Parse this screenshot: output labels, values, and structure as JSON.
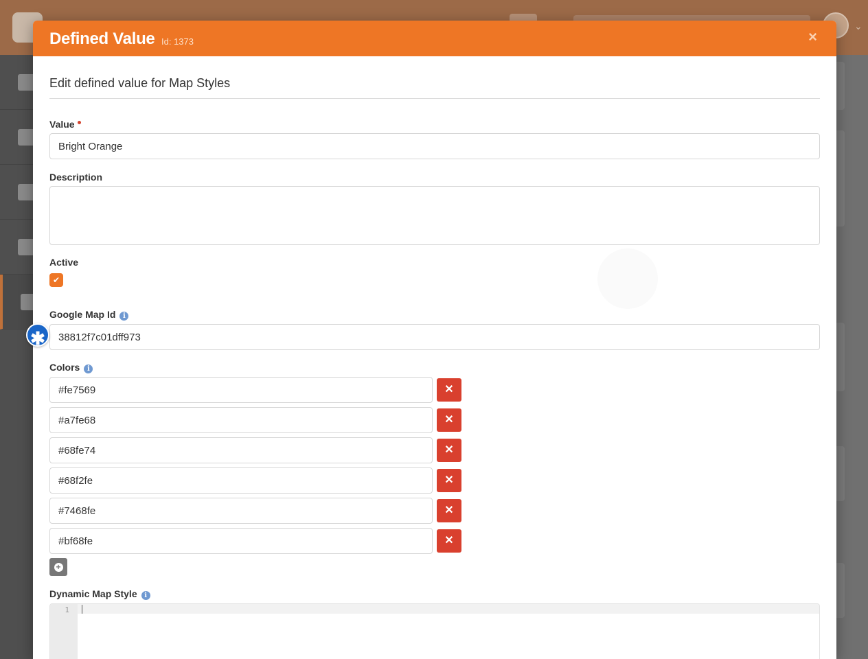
{
  "modal": {
    "title": "Defined Value",
    "id_label": "Id: 1373",
    "close_glyph": "×",
    "legend": "Edit defined value for Map Styles"
  },
  "fields": {
    "value_label": "Value",
    "value": "Bright Orange",
    "description_label": "Description",
    "description": "",
    "active_label": "Active",
    "active_checked": true,
    "google_map_id_label": "Google Map Id",
    "google_map_id": "38812f7c01dff973",
    "colors_label": "Colors",
    "colors": [
      "#fe7569",
      "#a7fe68",
      "#68fe74",
      "#68f2fe",
      "#7468fe",
      "#bf68fe"
    ],
    "dynamic_map_style_label": "Dynamic Map Style",
    "code_line_number": "1"
  },
  "icons": {
    "info": "info-icon",
    "check": "check-icon",
    "remove": "times-icon",
    "add": "plus-circle-icon",
    "badge": "asterisk-icon"
  },
  "theme": {
    "accent": "#ee7625",
    "danger": "#d9402e",
    "info": "#6f99d1",
    "badge": "#1a66c8"
  }
}
